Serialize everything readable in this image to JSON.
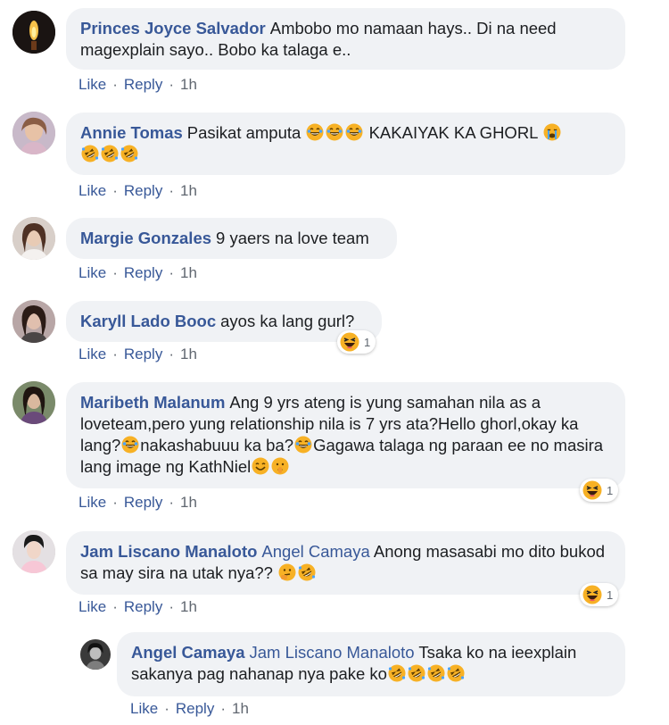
{
  "actions": {
    "like": "Like",
    "reply": "Reply",
    "sep": "·"
  },
  "colors": {
    "author_link": "#385898",
    "bubble_bg": "#f0f2f5",
    "meta_gray": "#606770"
  },
  "comments": [
    {
      "author": "Princes Joyce Salvador",
      "mention": "",
      "text": "Ambobo mo namaan hays.. Di na need magexplain sayo.. Bobo ka talaga e..",
      "time": "1h",
      "avatar": "candle-avatar"
    },
    {
      "author": "Annie Tomas",
      "mention": "",
      "text": "Pasikat amputa",
      "text2": "KAKAIYAK KA GHORL",
      "time": "1h",
      "avatar": "woman-avatar"
    },
    {
      "author": "Margie Gonzales",
      "mention": "",
      "text": "9 yaers na love team",
      "time": "1h",
      "avatar": "woman-avatar"
    },
    {
      "author": "Karyll Lado Booc",
      "mention": "",
      "text": "ayos ka lang gurl?",
      "time": "1h",
      "avatar": "woman-avatar",
      "reaction_count": "1"
    },
    {
      "author": "Maribeth Malanum",
      "mention": "",
      "text1": "Ang 9 yrs ateng is yung samahan nila as a loveteam,pero yung relationship nila is 7 yrs ata?Hello ghorl,okay ka lang?",
      "text2": "nakashabuuu ka ba?",
      "text3": "Gagawa talaga ng paraan ee no masira lang image ng KathNiel",
      "time": "1h",
      "avatar": "woman-avatar",
      "reaction_count": "1"
    },
    {
      "author": "Jam Liscano Manaloto",
      "mention": "Angel Camaya",
      "text": "Anong masasabi mo dito bukod sa may sira na utak nya??",
      "time": "1h",
      "avatar": "woman-avatar",
      "reaction_count": "1"
    },
    {
      "author": "Angel Camaya",
      "mention": "Jam Liscano Manaloto",
      "text": "Tsaka ko na ieexplain sakanya pag nahanap nya pake ko",
      "time": "1h",
      "avatar": "bw-avatar"
    }
  ]
}
